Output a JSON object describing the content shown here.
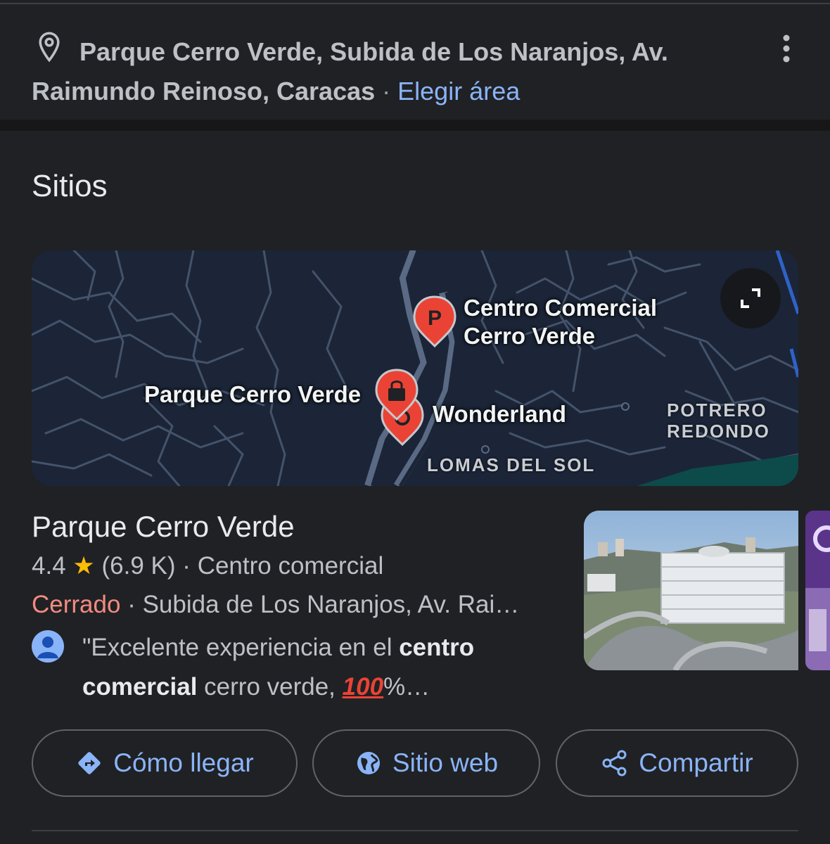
{
  "location": {
    "line1": "Parque Cerro Verde, Subida de Los Naranjos, Av.",
    "line2": "Raimundo Reinoso, Caracas",
    "separator": " · ",
    "change_area": "Elegir área"
  },
  "section": {
    "title": "Sitios"
  },
  "map": {
    "markers": [
      {
        "label_line1": "Centro Comercial",
        "label_line2": "Cerro Verde",
        "icon": "P"
      },
      {
        "label": "Parque Cerro Verde",
        "icon": "shopping-bag-icon"
      },
      {
        "label": "Wonderland",
        "icon": "amusement-icon"
      }
    ],
    "districts": {
      "potrero_line1": "POTRERO",
      "potrero_line2": "REDONDO",
      "lomas": "LOMAS DEL SOL"
    }
  },
  "place": {
    "name": "Parque Cerro Verde",
    "rating": "4.4",
    "star": "★",
    "reviews": "(6.9 K)",
    "category": "Centro comercial",
    "status": "Cerrado",
    "address": "Subida de Los Naranjos, Av. Rai…",
    "review": {
      "part1": "\"Excelente experiencia en el ",
      "bold1": "centro",
      "bold2": "comercial",
      "part2": " cerro verde, ",
      "emoji": "100",
      "part3": "%…"
    }
  },
  "actions": {
    "directions": "Cómo llegar",
    "website": "Sitio web",
    "share": "Compartir"
  },
  "colors": {
    "background": "#202124",
    "link": "#8ab4f8",
    "closed": "#f28b82",
    "star": "#fbbc04",
    "marker": "#ea4335"
  }
}
